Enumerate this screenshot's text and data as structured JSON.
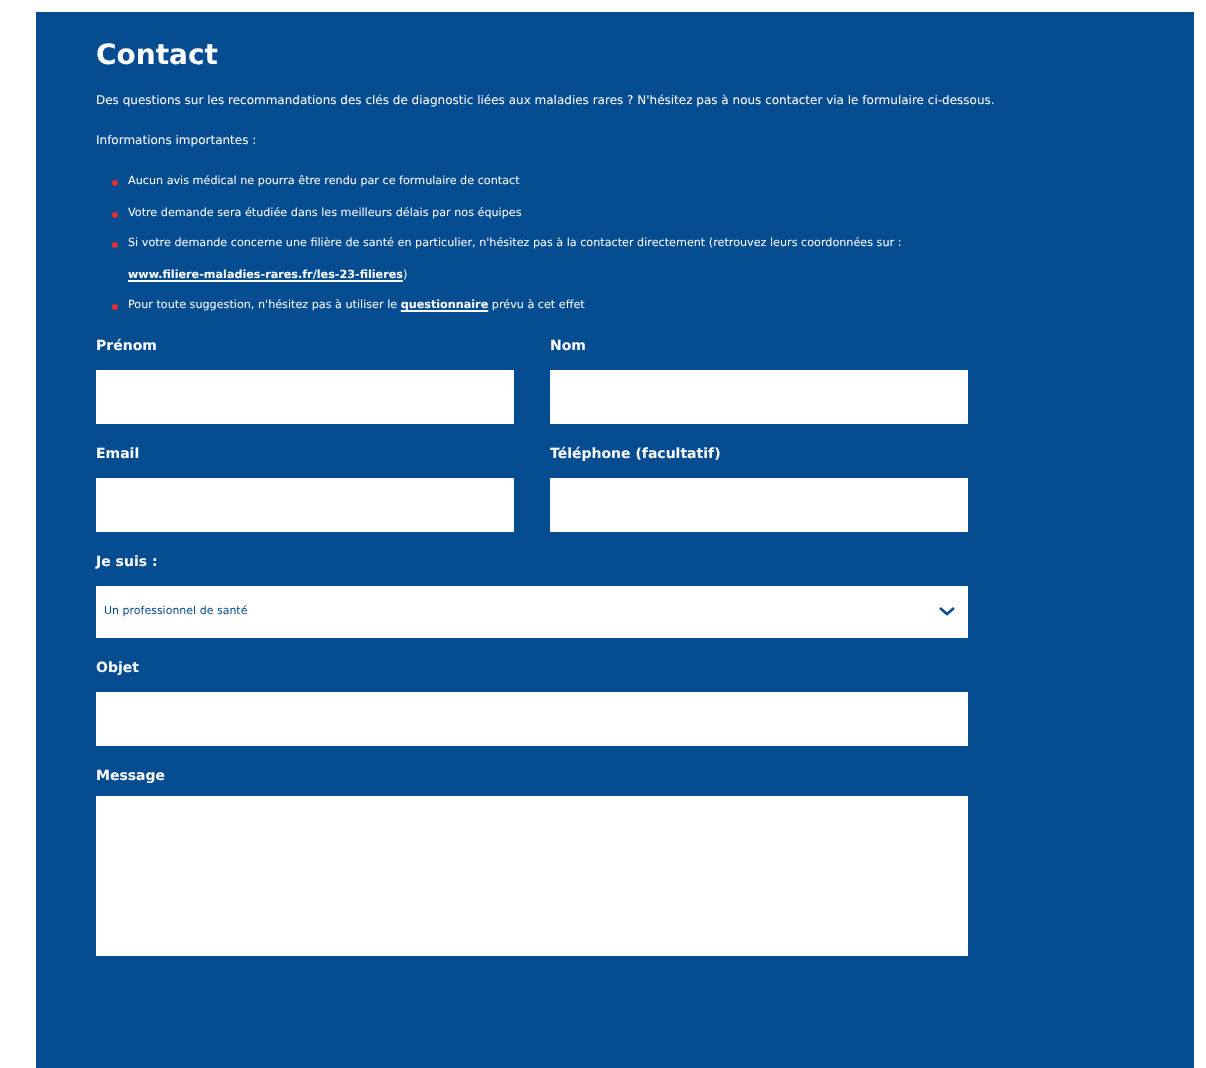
{
  "title": "Contact",
  "intro": "Des questions sur les recommandations des clés de diagnostic liées aux maladies rares ? N'hésitez pas à nous contacter via le formulaire ci-dessous.",
  "info_heading": "Informations importantes :",
  "bullets": [
    {
      "parts": [
        {
          "kind": "text",
          "text": "Aucun avis médical ne pourra être rendu par ce formulaire de contact"
        }
      ]
    },
    {
      "parts": [
        {
          "kind": "text",
          "text": "Votre demande sera étudiée dans les meilleurs délais par nos équipes"
        }
      ]
    },
    {
      "parts": [
        {
          "kind": "text",
          "text": "Si votre demande concerne une filière de santé en particulier, n'hésitez pas à la contacter directement (retrouvez leurs coordonnées sur : "
        },
        {
          "kind": "link",
          "text": "www.filiere-maladies-rares.fr/les-23-filieres"
        },
        {
          "kind": "text",
          "text": ")"
        }
      ]
    },
    {
      "parts": [
        {
          "kind": "text",
          "text": "Pour toute suggestion, n'hésitez pas à utiliser le "
        },
        {
          "kind": "link",
          "text": "questionnaire"
        },
        {
          "kind": "text",
          "text": " prévu à cet effet"
        }
      ]
    }
  ],
  "form_rows": [
    [
      {
        "kind": "text",
        "label": "Prénom"
      },
      {
        "kind": "text",
        "label": "Nom"
      }
    ],
    [
      {
        "kind": "text",
        "label": "Email"
      },
      {
        "kind": "text",
        "label": "Téléphone (facultatif)"
      }
    ],
    [
      {
        "kind": "select",
        "label": "Je suis :",
        "value": "Un professionnel de santé"
      }
    ],
    [
      {
        "kind": "text",
        "label": "Objet"
      }
    ],
    [
      {
        "kind": "textarea",
        "label": "Message"
      }
    ]
  ]
}
